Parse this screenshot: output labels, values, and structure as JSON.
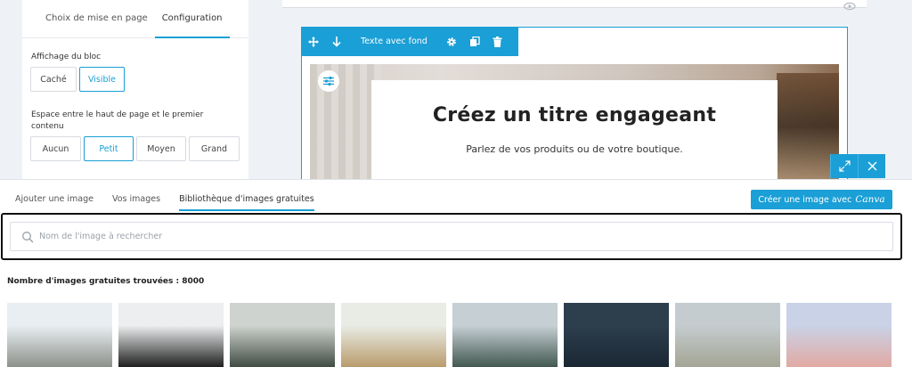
{
  "settings_panel": {
    "tabs": [
      "Choix de mise en page",
      "Configuration"
    ],
    "active_tab": "Configuration",
    "display_label": "Affichage du bloc",
    "display_options": [
      "Caché",
      "Visible"
    ],
    "display_selected": "Visible",
    "spacing_label": "Espace entre le haut de page et le premier contenu",
    "spacing_options": [
      "Aucun",
      "Petit",
      "Moyen",
      "Grand"
    ],
    "spacing_selected": "Petit"
  },
  "block": {
    "toolbar_title": "Texte avec fond",
    "heading": "Créez un titre engageant",
    "subtitle": "Parlez de vos produits ou de votre boutique."
  },
  "library": {
    "tabs": [
      "Ajouter une image",
      "Vos images",
      "Bibliothèque d'images gratuites"
    ],
    "active_tab": "Bibliothèque d'images gratuites",
    "canva_button_label": "Créer une image avec",
    "canva_brand": "Canva",
    "search_placeholder": "Nom de l'image à rechercher",
    "result_count_text": "Nombre d'images gratuites trouvées : 8000",
    "thumbnails": [
      {
        "alt": "mountain landscape",
        "colors": [
          "#e9eef2",
          "#8a8f88"
        ]
      },
      {
        "alt": "silhouette portrait",
        "colors": [
          "#eceeef",
          "#1b1b1b"
        ]
      },
      {
        "alt": "coffee cup",
        "colors": [
          "#cfd3cf",
          "#3d4a40"
        ]
      },
      {
        "alt": "hedgehog in flowers",
        "colors": [
          "#e8ece4",
          "#b89a6a"
        ]
      },
      {
        "alt": "misty forest",
        "colors": [
          "#c6cfd4",
          "#40564d"
        ]
      },
      {
        "alt": "dark blue water",
        "colors": [
          "#2d3e4d",
          "#1a2733"
        ]
      },
      {
        "alt": "hazy horizon",
        "colors": [
          "#c5cccf",
          "#a3a493"
        ]
      },
      {
        "alt": "woman sunglasses",
        "colors": [
          "#c9d2e6",
          "#e2a9a2"
        ]
      }
    ]
  },
  "colors": {
    "accent": "#1a9fd6"
  }
}
